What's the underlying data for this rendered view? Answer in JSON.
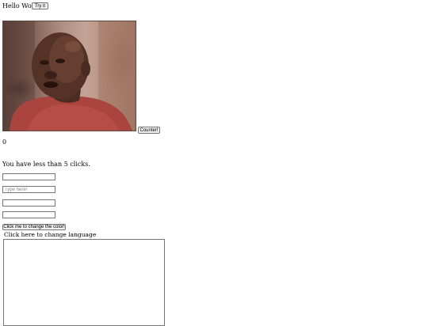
{
  "greeting": "Hello World!",
  "try_button": "Try it",
  "counter_button": "Counter!",
  "counter_value": "0",
  "clicks_message": "You have less than 5 clicks.",
  "inputs": {
    "field1_value": "",
    "field2_placeholder": "Type here!",
    "field3_value": "",
    "field4_value": ""
  },
  "color_button": "Click me to change the color!",
  "language_label": "Click here to change language",
  "textarea_value": ""
}
